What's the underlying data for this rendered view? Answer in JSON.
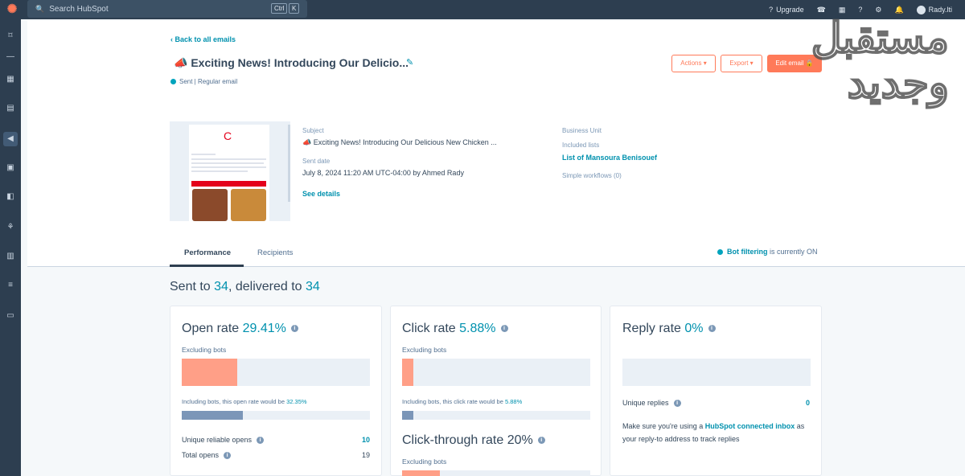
{
  "topbar": {
    "search_placeholder": "Search HubSpot",
    "shortcut_ctrl": "Ctrl",
    "shortcut_k": "K",
    "upgrade_label": "Upgrade",
    "user_name": "Rady.lti"
  },
  "header": {
    "back_label": "Back to all emails",
    "emoji": "📣",
    "title": "Exciting News! Introducing Our Delicio...",
    "status": "Sent | Regular email",
    "actions_label": "Actions ▾",
    "export_label": "Export ▾",
    "edit_label": "Edit email 🔒"
  },
  "details": {
    "subject_label": "Subject",
    "subject_value": "📣 Exciting News! Introducing Our Delicious New Chicken ...",
    "sent_date_label": "Sent date",
    "sent_date_value": "July 8, 2024 11:20 AM UTC-04:00 by Ahmed Rady",
    "see_details": "See details",
    "business_unit_label": "Business Unit",
    "included_lists_label": "Included lists",
    "included_list_value": "List of Mansoura Benisouef",
    "simple_workflows": "Simple workflows (0)"
  },
  "tabs": {
    "performance": "Performance",
    "recipients": "Recipients"
  },
  "bot_filtering": {
    "link": "Bot filtering",
    "rest": "is currently ON"
  },
  "summary": {
    "sent_prefix": "Sent to ",
    "sent_count": "34",
    "delivered_prefix": ", delivered to ",
    "delivered_count": "34"
  },
  "open_card": {
    "title": "Open rate ",
    "pct": "29.41%",
    "excluding": "Excluding bots",
    "fill_fraction": 0.2941,
    "including_text": "Including bots, this open rate would be ",
    "including_pct": "32.35%",
    "including_fraction": 0.3235,
    "unique_label": "Unique reliable opens",
    "unique_value": "10",
    "total_label": "Total opens",
    "total_value": "19"
  },
  "click_card": {
    "title": "Click rate ",
    "pct": "5.88%",
    "excluding": "Excluding bots",
    "fill_fraction": 0.0588,
    "including_text": "Including bots, this click rate would be ",
    "including_pct": "5.88%",
    "including_fraction": 0.0588,
    "ctr_title": "Click-through rate ",
    "ctr_pct": "20%",
    "ctr_excluding": "Excluding bots",
    "ctr_fraction": 0.2
  },
  "reply_card": {
    "title": "Reply rate ",
    "pct": "0%",
    "fill_fraction": 0,
    "unique_label": "Unique replies",
    "unique_value": "0",
    "note_prefix": "Make sure you're using a ",
    "note_link": "HubSpot connected inbox",
    "note_suffix": " as",
    "note_line2": "your reply-to address to track replies"
  },
  "watermark": {
    "line1": "مستقبل",
    "line2": "وجديد"
  },
  "colors": {
    "accent": "#0091ae",
    "orange": "#ff7a59",
    "open_fill": "#ff9f87",
    "blue_fill": "#7b96b8",
    "nav": "#2d3e50"
  }
}
